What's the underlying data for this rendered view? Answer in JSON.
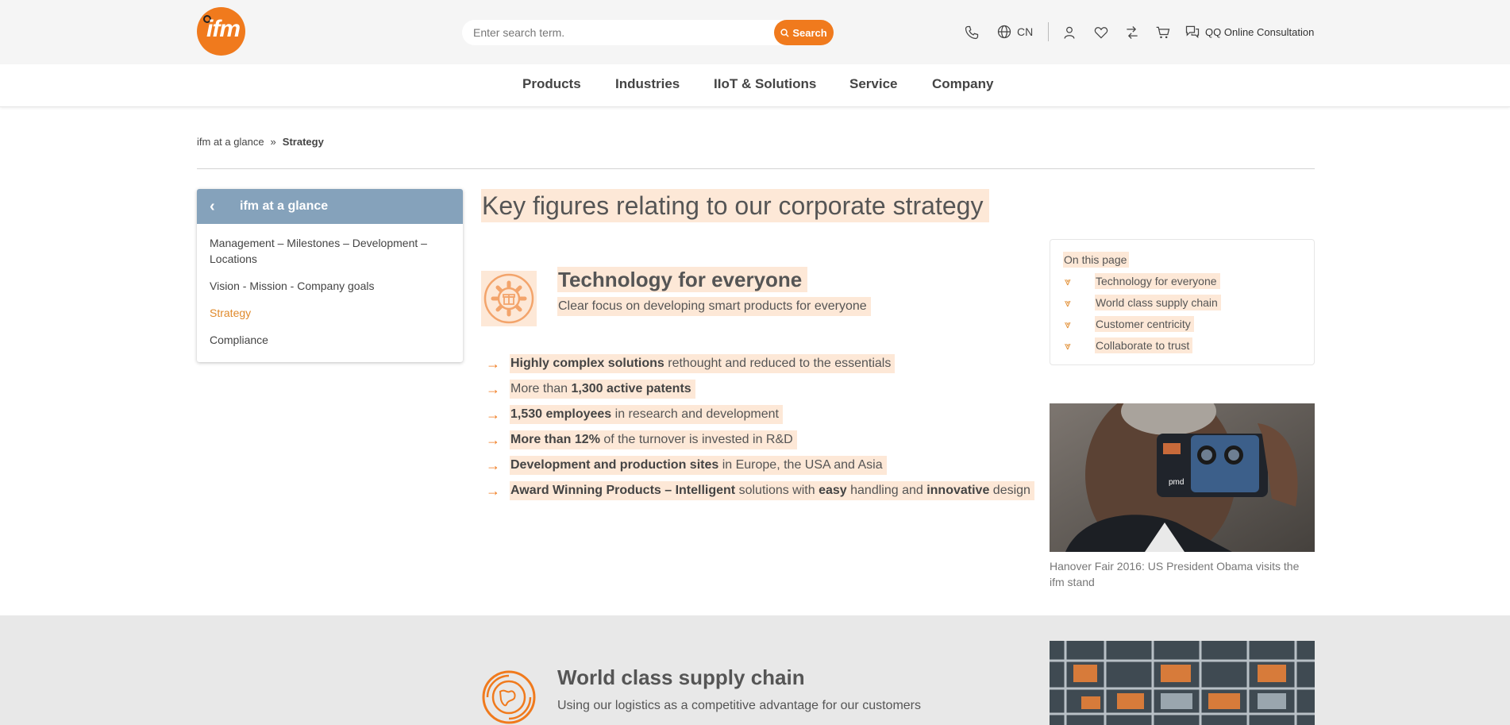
{
  "header": {
    "logo_text": "ifm",
    "search_placeholder": "Enter search term.",
    "search_button": "Search",
    "language": "CN",
    "consultation": "QQ Online Consultation",
    "icons": [
      "phone-icon",
      "globe-icon",
      "user-icon",
      "heart-icon",
      "compare-icon",
      "cart-icon",
      "chat-icon"
    ]
  },
  "nav": [
    "Products",
    "Industries",
    "IIoT & Solutions",
    "Service",
    "Company"
  ],
  "breadcrumb": {
    "parent": "ifm at a glance",
    "sep": "»",
    "current": "Strategy"
  },
  "sidebar": {
    "title": "ifm at a glance",
    "items": [
      {
        "label": "Management – Milestones – Development – Locations",
        "active": false
      },
      {
        "label": "Vision - Mission - Company goals",
        "active": false
      },
      {
        "label": "Strategy",
        "active": true
      },
      {
        "label": "Compliance",
        "active": false
      }
    ]
  },
  "main": {
    "title": "Key figures relating to our corporate strategy",
    "section1": {
      "heading": "Technology for everyone",
      "subheading": "Clear focus on developing smart products for everyone",
      "bullets": [
        [
          {
            "b": "Highly complex solutions"
          },
          {
            "t": " rethought and reduced to the essentials"
          }
        ],
        [
          {
            "t": "More than "
          },
          {
            "b": "1,300 active patents"
          }
        ],
        [
          {
            "b": "1,530 employees"
          },
          {
            "t": " in research and development"
          }
        ],
        [
          {
            "b": "More than 12%"
          },
          {
            "t": " of the turnover is invested in R&D"
          }
        ],
        [
          {
            "b": "Development and production sites"
          },
          {
            "t": " in Europe, the USA and Asia"
          }
        ],
        [
          {
            "b": "Award Winning Products – Intelligent"
          },
          {
            "t": " solutions with "
          },
          {
            "b": "easy"
          },
          {
            "t": " handling and "
          },
          {
            "b": "innovative"
          },
          {
            "t": " design"
          }
        ]
      ]
    },
    "section2": {
      "heading": "World class supply chain",
      "subheading": "Using our logistics as a competitive advantage for our customers"
    }
  },
  "on_this_page": {
    "title": "On this page",
    "items": [
      "Technology for everyone",
      "World class supply chain",
      "Customer centricity",
      "Collaborate to trust"
    ]
  },
  "photo": {
    "device_label": "pmd",
    "caption": "Hanover Fair 2016: US President Obama visits the ifm stand"
  },
  "colors": {
    "accent": "#f07a1d",
    "highlight": "#fde8d7",
    "sidebar_header": "#85a2bb",
    "active_link": "#e08a2c"
  }
}
